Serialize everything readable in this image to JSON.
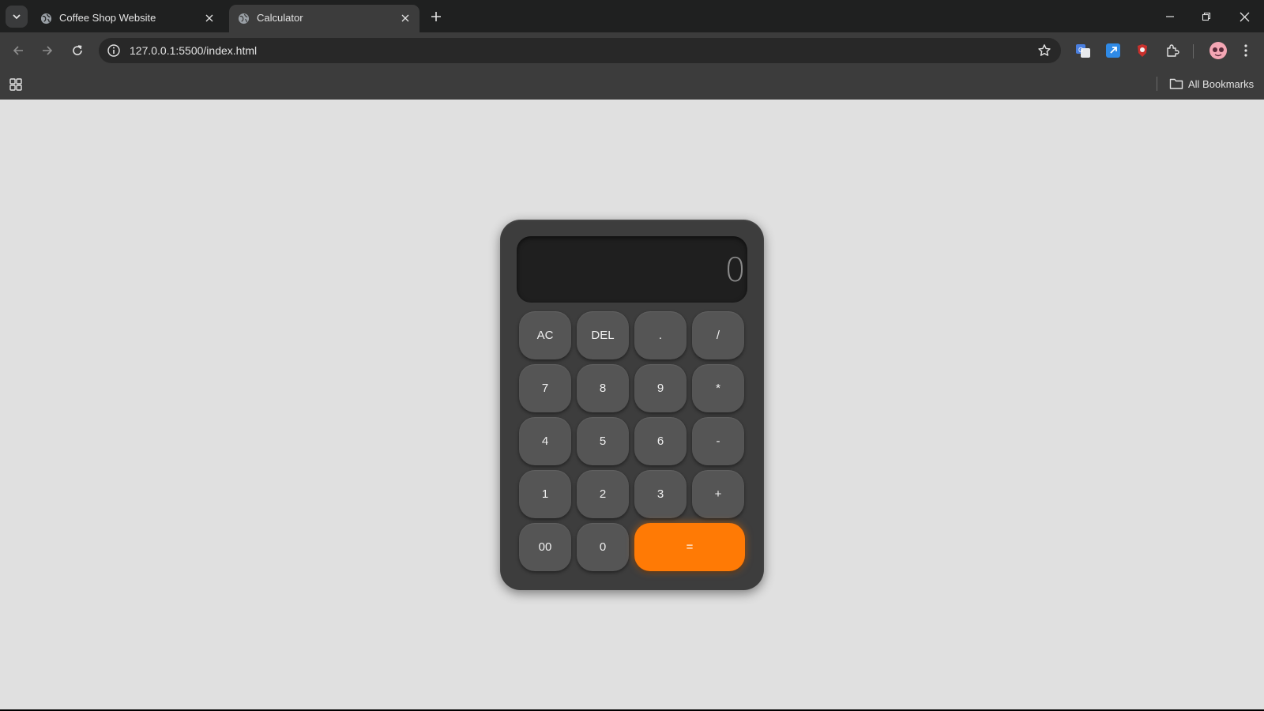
{
  "browser": {
    "tabs": [
      {
        "title": "Coffee Shop Website",
        "active": false
      },
      {
        "title": "Calculator",
        "active": true
      }
    ],
    "url": "127.0.0.1:5500/index.html",
    "bookmarks_label": "All Bookmarks"
  },
  "calculator": {
    "display": "0",
    "keys": {
      "ac": "AC",
      "del": "DEL",
      "dot": ".",
      "divide": "/",
      "seven": "7",
      "eight": "8",
      "nine": "9",
      "multiply": "*",
      "four": "4",
      "five": "5",
      "six": "6",
      "minus": "-",
      "one": "1",
      "two": "2",
      "three": "3",
      "plus": "+",
      "double_zero": "00",
      "zero": "0",
      "equals": "="
    },
    "accent_color": "#ff7a05"
  }
}
